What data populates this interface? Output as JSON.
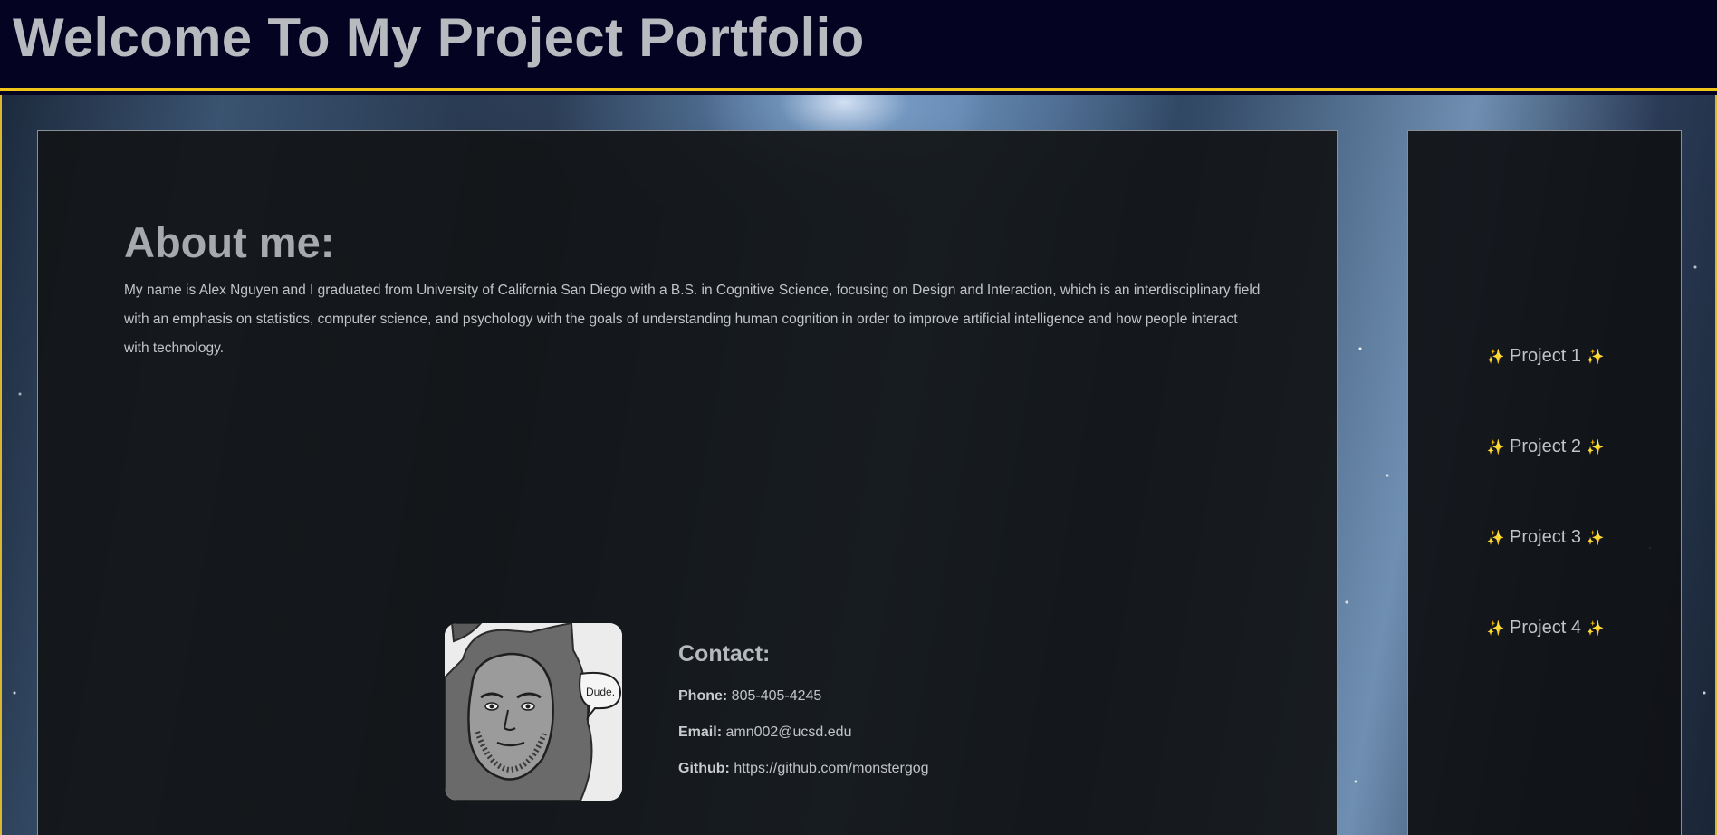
{
  "header": {
    "title": "Welcome To My Project Portfolio"
  },
  "about": {
    "title": "About me:",
    "text": "My name is Alex Nguyen and I graduated from University of California San Diego with a B.S. in Cognitive Science, focusing on Design and Interaction, which is an interdisciplinary field with an emphasis on statistics, computer science, and psychology with the goals of understanding human cognition in order to improve artificial intelligence and how people interact with technology."
  },
  "avatar": {
    "speech_bubble": "Dude."
  },
  "contact": {
    "title": "Contact:",
    "phone_label": "Phone:",
    "phone": "805-405-4245",
    "email_label": "Email:",
    "email": "amn002@ucsd.edu",
    "github_label": "Github:",
    "github": "https://github.com/monstergog"
  },
  "projects": [
    {
      "label": "Project 1"
    },
    {
      "label": "Project 2"
    },
    {
      "label": "Project 3"
    },
    {
      "label": "Project 4"
    }
  ],
  "sparkle_icon": "✨",
  "colors": {
    "header_bg": "#040322",
    "accent_border": "#f0c419",
    "panel_bg": "#121417"
  }
}
